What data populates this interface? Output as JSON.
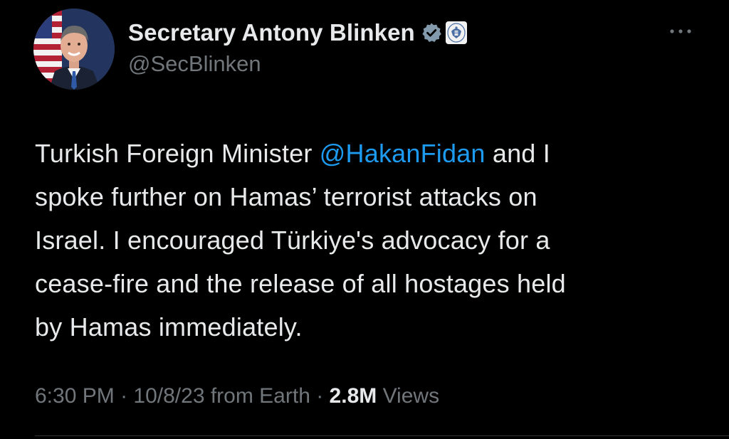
{
  "author": {
    "display_name": "Secretary Antony Blinken",
    "handle": "@SecBlinken",
    "verified_badge": "verified-check-icon",
    "affiliate_badge": "state-department-seal-icon",
    "avatar": "profile-photo"
  },
  "tweet": {
    "line1_before": "Turkish Foreign Minister ",
    "mention": "@HakanFidan",
    "line1_after": " and I",
    "line2": "spoke further on Hamas’ terrorist attacks on",
    "line3": "Israel. I encouraged Türkiye's advocacy for a",
    "line4": "cease-fire and the release of all hostages held",
    "line5": "by Hamas immediately."
  },
  "meta": {
    "time": "6:30 PM",
    "sep1": " · ",
    "date": "10/8/23",
    "source": " from Earth",
    "sep2": " · ",
    "views_count": "2.8M",
    "views_label": " Views"
  },
  "icons": {
    "more": "more-options-icon"
  },
  "colors": {
    "background": "#000000",
    "text": "#e7e9ea",
    "secondary": "#71767b",
    "link": "#1d9bf0",
    "verified_badge": "#829aab"
  }
}
